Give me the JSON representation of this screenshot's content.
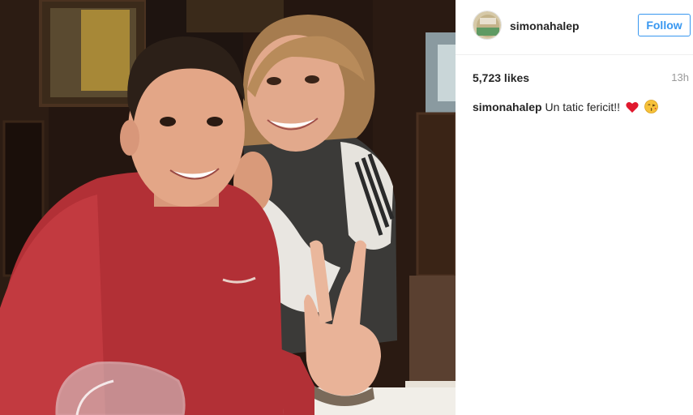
{
  "post": {
    "image_alt": "Selfie of two people at a restaurant table",
    "header": {
      "username": "simonahalep",
      "follow_label": "Follow"
    },
    "likes": "5,723 likes",
    "time": "13h",
    "caption": {
      "username": "simonahalep",
      "text": "Un tatic fericit!!",
      "emojis": [
        "red-heart-emoji",
        "kissing-face-emoji"
      ]
    }
  },
  "colors": {
    "accent_blue": "#3897f0",
    "text": "#262626",
    "muted": "#999999",
    "divider": "#efefef",
    "heart_red": "#e0192e"
  }
}
